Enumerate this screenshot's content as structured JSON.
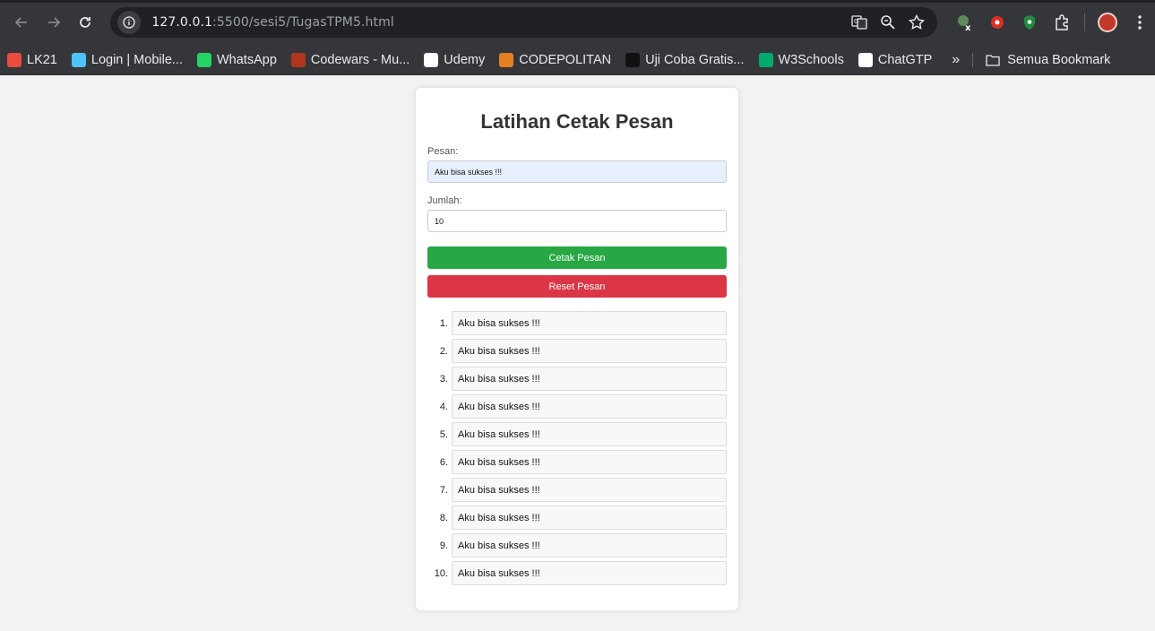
{
  "browser": {
    "url_host": "127.0.0.1",
    "url_path": ":5500/sesi5/TugasTPM5.html",
    "bookmarks": [
      {
        "label": "LK21",
        "icon": "lk21-favicon",
        "color": "#e74c3c"
      },
      {
        "label": "Login | Mobile...",
        "icon": "login-favicon",
        "color": "#4fc3f7"
      },
      {
        "label": "WhatsApp",
        "icon": "whatsapp-favicon",
        "color": "#25d366"
      },
      {
        "label": "Codewars - Mu...",
        "icon": "codewars-favicon",
        "color": "#b1361e"
      },
      {
        "label": "Udemy",
        "icon": "udemy-favicon",
        "color": "#ffffff"
      },
      {
        "label": "CODEPOLITAN",
        "icon": "codepolitan-favicon",
        "color": "#e67e22"
      },
      {
        "label": "Uji Coba Gratis...",
        "icon": "hr-favicon",
        "color": "#111111"
      },
      {
        "label": "W3Schools",
        "icon": "w3schools-favicon",
        "color": "#04aa6d"
      },
      {
        "label": "ChatGTP",
        "icon": "chatgpt-favicon",
        "color": "#ffffff"
      }
    ],
    "more_bookmarks": "»",
    "folder_label": "Semua Bookmark"
  },
  "page": {
    "title": "Latihan Cetak Pesan",
    "pesan_label": "Pesan:",
    "pesan_value": "Aku bisa sukses !!!",
    "jumlah_label": "Jumlah:",
    "jumlah_value": "10",
    "print_button": "Cetak Pesan",
    "reset_button": "Reset Pesan",
    "messages": [
      "Aku bisa sukses !!!",
      "Aku bisa sukses !!!",
      "Aku bisa sukses !!!",
      "Aku bisa sukses !!!",
      "Aku bisa sukses !!!",
      "Aku bisa sukses !!!",
      "Aku bisa sukses !!!",
      "Aku bisa sukses !!!",
      "Aku bisa sukses !!!",
      "Aku bisa sukses !!!"
    ]
  },
  "colors": {
    "print_button": "#28a745",
    "reset_button": "#dc3545",
    "autofill": "#e8f0fe"
  }
}
